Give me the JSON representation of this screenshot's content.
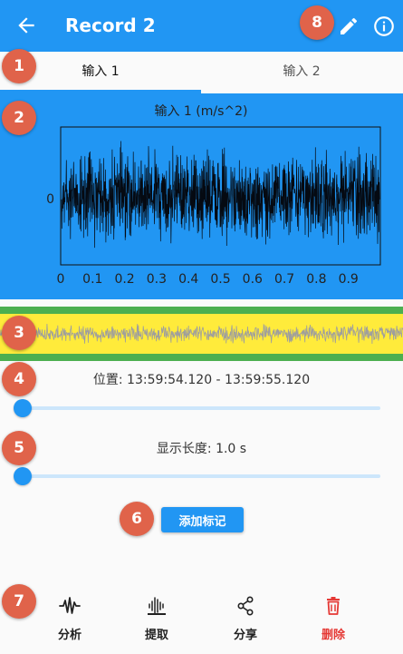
{
  "appbar": {
    "title": "Record 2"
  },
  "tabs": [
    {
      "label": "输入 1",
      "active": true
    },
    {
      "label": "输入 2",
      "active": false
    }
  ],
  "chart_data": {
    "type": "line",
    "title": "输入 1 (m/s^2)",
    "xlabel": "",
    "ylabel": "",
    "xlim": [
      0,
      1.0
    ],
    "x_ticks": [
      "0",
      "0.1",
      "0.2",
      "0.3",
      "0.4",
      "0.5",
      "0.6",
      "0.7",
      "0.8",
      "0.9"
    ],
    "y_ticks": [
      "0"
    ],
    "series": [
      {
        "color": "#000000",
        "description": "dense zero-mean vibration signal filling roughly 80% of the plot height"
      }
    ]
  },
  "position": {
    "label": "位置: 13:59:54.120 -  13:59:55.120",
    "value": 0
  },
  "display_length": {
    "label": "显示长度: 1.0 s",
    "value": 0
  },
  "add_mark_button": "添加标记",
  "bottom_nav": [
    {
      "label": "分析",
      "icon": "waveform-icon"
    },
    {
      "label": "提取",
      "icon": "extract-icon"
    },
    {
      "label": "分享",
      "icon": "share-icon"
    },
    {
      "label": "删除",
      "icon": "trash-icon"
    }
  ],
  "markers": [
    "1",
    "2",
    "3",
    "4",
    "5",
    "6",
    "7",
    "8"
  ],
  "colors": {
    "primary": "#2196f3",
    "marker": "#e0634a",
    "overview_green": "#4caf50",
    "overview_yellow": "#ffeb3b",
    "overview_wave": "#9e9e9e",
    "delete": "#e53935"
  }
}
